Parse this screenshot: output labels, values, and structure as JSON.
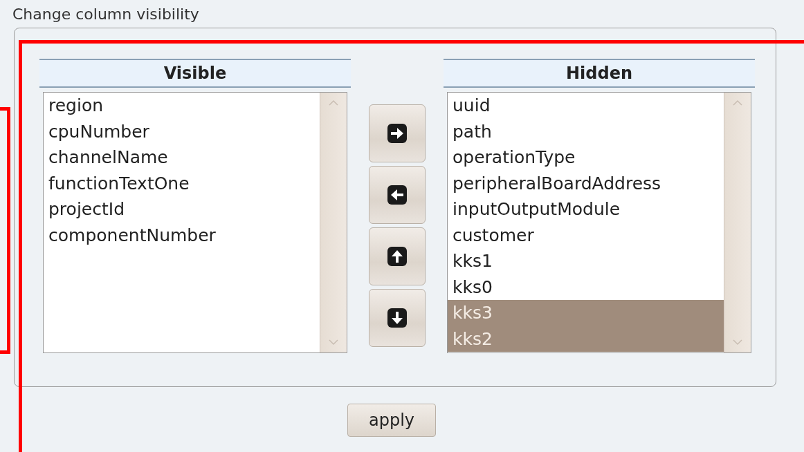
{
  "title": "Change column visibility",
  "lists": [
    {
      "header": "Visible",
      "items": [
        {
          "label": "region",
          "selected": false
        },
        {
          "label": "cpuNumber",
          "selected": false
        },
        {
          "label": "channelName",
          "selected": false
        },
        {
          "label": "functionTextOne",
          "selected": false
        },
        {
          "label": "projectId",
          "selected": false
        },
        {
          "label": "componentNumber",
          "selected": false
        }
      ]
    },
    {
      "header": "Hidden",
      "items": [
        {
          "label": "uuid",
          "selected": false
        },
        {
          "label": "path",
          "selected": false
        },
        {
          "label": "operationType",
          "selected": false
        },
        {
          "label": "peripheralBoardAddress",
          "selected": false
        },
        {
          "label": "inputOutputModule",
          "selected": false
        },
        {
          "label": "customer",
          "selected": false
        },
        {
          "label": "kks1",
          "selected": false
        },
        {
          "label": "kks0",
          "selected": false
        },
        {
          "label": "kks3",
          "selected": true
        },
        {
          "label": "kks2",
          "selected": true
        }
      ]
    }
  ],
  "move_buttons": [
    {
      "kind": "right"
    },
    {
      "kind": "left"
    },
    {
      "kind": "up"
    },
    {
      "kind": "down"
    }
  ],
  "apply_button": "apply"
}
